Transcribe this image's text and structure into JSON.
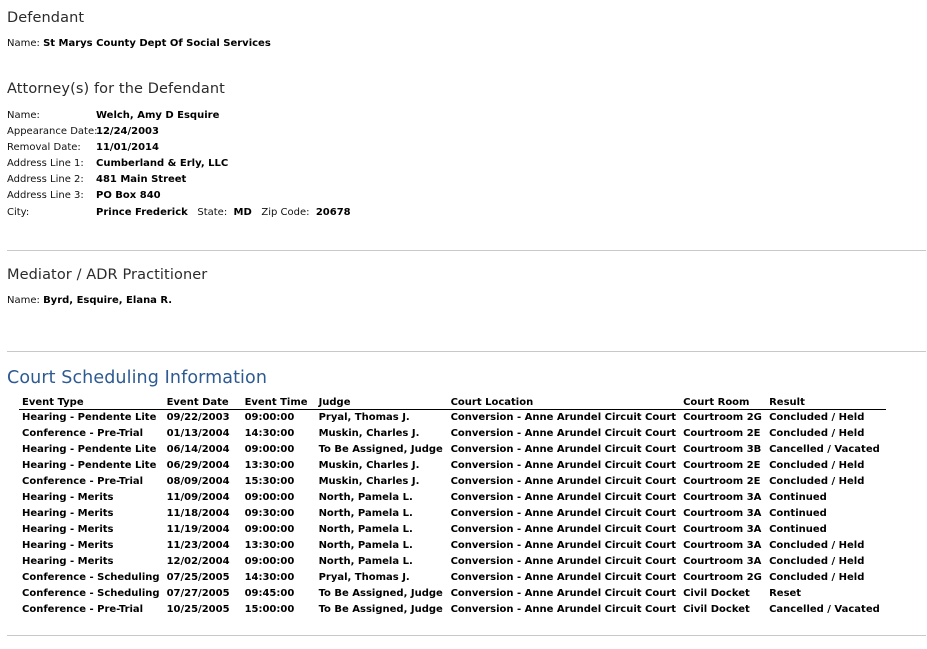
{
  "defendant": {
    "heading": "Defendant",
    "name_label": "Name:",
    "name_value": "St Marys County Dept Of Social Services"
  },
  "attorney": {
    "heading": "Attorney(s) for the Defendant",
    "fields": [
      {
        "label": "Name:",
        "value": "Welch, Amy D Esquire"
      },
      {
        "label": "Appearance Date:",
        "value": "12/24/2003"
      },
      {
        "label": "Removal Date:",
        "value": "11/01/2014"
      },
      {
        "label": "Address Line 1:",
        "value": "Cumberland & Erly, LLC"
      },
      {
        "label": "Address Line 2:",
        "value": "481 Main Street"
      },
      {
        "label": "Address Line 3:",
        "value": "PO Box 840"
      }
    ],
    "city_label": "City:",
    "city_value": "Prince Frederick",
    "state_label": "State:",
    "state_value": "MD",
    "zip_label": "Zip Code:",
    "zip_value": "20678"
  },
  "mediator": {
    "heading": "Mediator / ADR Practitioner",
    "name_label": "Name:",
    "name_value": "Byrd, Esquire, Elana R."
  },
  "scheduling": {
    "heading": "Court Scheduling Information",
    "columns": [
      "Event Type",
      "Event Date",
      "Event Time",
      "Judge",
      "Court Location",
      "Court Room",
      "Result"
    ],
    "rows": [
      [
        "Hearing - Pendente Lite",
        "09/22/2003",
        "09:00:00",
        "Pryal, Thomas J.",
        "Conversion - Anne Arundel Circuit Court",
        "Courtroom 2G",
        "Concluded / Held"
      ],
      [
        "Conference - Pre-Trial",
        "01/13/2004",
        "14:30:00",
        "Muskin, Charles J.",
        "Conversion - Anne Arundel Circuit Court",
        "Courtroom 2E",
        "Concluded / Held"
      ],
      [
        "Hearing - Pendente Lite",
        "06/14/2004",
        "09:00:00",
        "To Be Assigned, Judge",
        "Conversion - Anne Arundel Circuit Court",
        "Courtroom 3B",
        "Cancelled / Vacated"
      ],
      [
        "Hearing - Pendente Lite",
        "06/29/2004",
        "13:30:00",
        "Muskin, Charles J.",
        "Conversion - Anne Arundel Circuit Court",
        "Courtroom 2E",
        "Concluded / Held"
      ],
      [
        "Conference - Pre-Trial",
        "08/09/2004",
        "15:30:00",
        "Muskin, Charles J.",
        "Conversion - Anne Arundel Circuit Court",
        "Courtroom 2E",
        "Concluded / Held"
      ],
      [
        "Hearing - Merits",
        "11/09/2004",
        "09:00:00",
        "North, Pamela L.",
        "Conversion - Anne Arundel Circuit Court",
        "Courtroom 3A",
        "Continued"
      ],
      [
        "Hearing - Merits",
        "11/18/2004",
        "09:30:00",
        "North, Pamela L.",
        "Conversion - Anne Arundel Circuit Court",
        "Courtroom 3A",
        "Continued"
      ],
      [
        "Hearing - Merits",
        "11/19/2004",
        "09:00:00",
        "North, Pamela L.",
        "Conversion - Anne Arundel Circuit Court",
        "Courtroom 3A",
        "Continued"
      ],
      [
        "Hearing - Merits",
        "11/23/2004",
        "13:30:00",
        "North, Pamela L.",
        "Conversion - Anne Arundel Circuit Court",
        "Courtroom 3A",
        "Concluded / Held"
      ],
      [
        "Hearing - Merits",
        "12/02/2004",
        "09:00:00",
        "North, Pamela L.",
        "Conversion - Anne Arundel Circuit Court",
        "Courtroom 3A",
        "Concluded / Held"
      ],
      [
        "Conference - Scheduling",
        "07/25/2005",
        "14:30:00",
        "Pryal, Thomas J.",
        "Conversion - Anne Arundel Circuit Court",
        "Courtroom 2G",
        "Concluded / Held"
      ],
      [
        "Conference - Scheduling",
        "07/27/2005",
        "09:45:00",
        "To Be Assigned, Judge",
        "Conversion - Anne Arundel Circuit Court",
        "Civil Docket",
        "Reset"
      ],
      [
        "Conference - Pre-Trial",
        "10/25/2005",
        "15:00:00",
        "To Be Assigned, Judge",
        "Conversion - Anne Arundel Circuit Court",
        "Civil Docket",
        "Cancelled / Vacated"
      ]
    ]
  }
}
